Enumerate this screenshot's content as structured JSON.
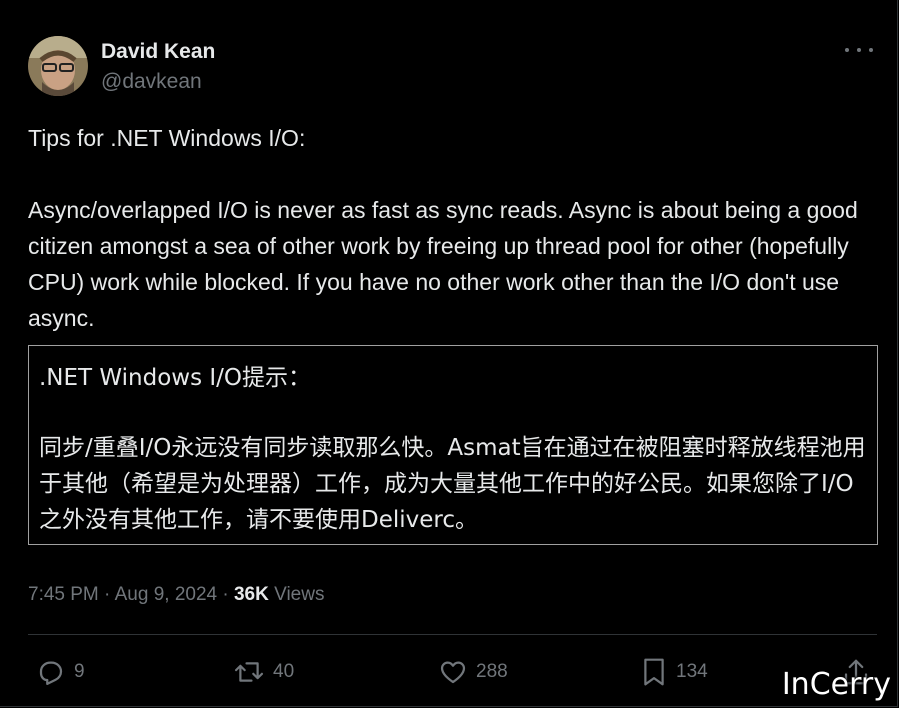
{
  "author": {
    "name": "David Kean",
    "handle": "@davkean"
  },
  "tweet": {
    "paragraphs": [
      "Tips for .NET Windows I/O:",
      "Async/overlapped I/O is never as fast as sync reads. Async is about being a good citizen amongst a sea of other work by freeing up thread pool for other (hopefully CPU) work while blocked. If you have no other work other than the I/O don't use async."
    ]
  },
  "translation": {
    "paragraphs": [
      ".NET Windows I/O提示：",
      "同步/重叠I/O永远没有同步读取那么快。Asmat旨在通过在被阻塞时释放线程池用于其他（希望是为处理器）工作，成为大量其他工作中的好公民。如果您除了I/O之外没有其他工作，请不要使用Deliverc。"
    ]
  },
  "meta": {
    "time": "7:45 PM",
    "separator1": " · ",
    "date": "Aug 9, 2024",
    "separator2": " · ",
    "views_count": "36K",
    "views_label": " Views"
  },
  "actions": {
    "replies": "9",
    "reposts": "40",
    "likes": "288",
    "bookmarks": "134"
  },
  "icons": [
    "more-icon",
    "reply-icon",
    "repost-icon",
    "like-icon",
    "bookmark-icon",
    "share-icon"
  ],
  "colors": {
    "background": "#000000",
    "text": "#e7e9ea",
    "muted": "#71767b",
    "border": "#2f3336"
  },
  "watermark": "InCerry"
}
